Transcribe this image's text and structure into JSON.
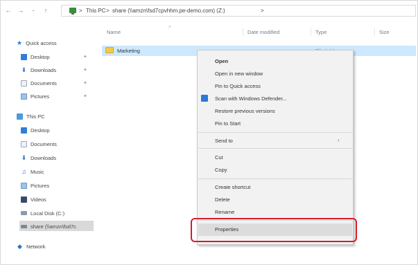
{
  "breadcrumb": {
    "items": [
      "This PC",
      "share (\\\\amzn\\fsd7cpvhhm.pe-demo.com) (Z:)"
    ],
    "separator": ">",
    "trailing": ">"
  },
  "sidebar": {
    "quick_access": "Quick access",
    "quick_items": [
      {
        "label": "Desktop",
        "icon": "desktop-icon"
      },
      {
        "label": "Downloads",
        "icon": "downloads-icon"
      },
      {
        "label": "Documents",
        "icon": "documents-icon"
      },
      {
        "label": "Pictures",
        "icon": "pictures-icon"
      }
    ],
    "this_pc": "This PC",
    "pc_items": [
      {
        "label": "Desktop",
        "icon": "desktop-icon"
      },
      {
        "label": "Documents",
        "icon": "documents-icon"
      },
      {
        "label": "Downloads",
        "icon": "downloads-icon"
      },
      {
        "label": "Music",
        "icon": "music-icon"
      },
      {
        "label": "Pictures",
        "icon": "pictures-icon"
      },
      {
        "label": "Videos",
        "icon": "videos-icon"
      },
      {
        "label": "Local Disk (C:)",
        "icon": "local-disk-icon"
      },
      {
        "label": "share (\\\\amzn\\fsd7c",
        "icon": "network-drive-icon"
      }
    ],
    "network": "Network"
  },
  "columns": {
    "name": "Name",
    "date_modified": "Date modified",
    "type": "Type",
    "size": "Size"
  },
  "files": [
    {
      "name": "Marketing",
      "date_modified": "",
      "type": "File folder",
      "icon": "folder-icon"
    }
  ],
  "context_menu": {
    "items": {
      "open": "Open",
      "open_new_window": "Open in new window",
      "pin_quick_access": "Pin to Quick access",
      "scan_defender": "Scan with Windows Defender...",
      "restore_versions": "Restore previous versions",
      "pin_start": "Pin to Start",
      "send_to": "Send to",
      "cut": "Cut",
      "copy": "Copy",
      "create_shortcut": "Create shortcut",
      "delete": "Delete",
      "rename": "Rename",
      "properties": "Properties"
    }
  },
  "colors": {
    "selection": "#cde8ff",
    "highlight_outline": "#d11f2a",
    "menu_background": "#f2f2f2"
  }
}
